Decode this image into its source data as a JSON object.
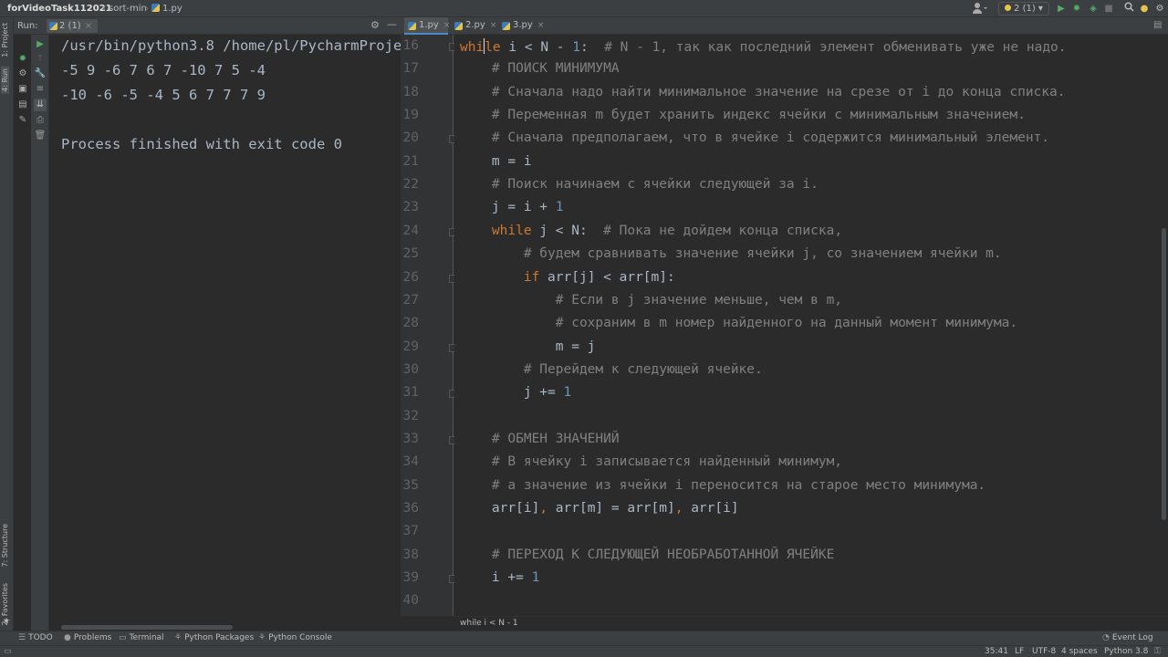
{
  "topbar": {
    "project": "forVideoTask112021",
    "sep": "›",
    "folder": "sort-min",
    "file": "1.py",
    "user_icon": "user-icon",
    "run_config": "2 (1)"
  },
  "sidebar": {
    "project": "1: Project",
    "run": "4: Run",
    "structure": "7: Structure",
    "favorites": "2: Favorites"
  },
  "run_panel": {
    "label": "Run:",
    "tab": "2 (1)",
    "tab_close": "×",
    "console_lines": [
      "/usr/bin/python3.8 /home/pl/PycharmProje",
      "-5 9 -6 7 6 7 -10 7 5 -4",
      "-10 -6 -5 -4 5 6 7 7 7 9",
      "",
      "Process finished with exit code 0"
    ]
  },
  "editor": {
    "tabs": [
      {
        "label": "1.py",
        "active": true
      },
      {
        "label": "2.py",
        "active": false
      },
      {
        "label": "3.py",
        "active": false
      }
    ],
    "tab_close": "×",
    "breadcrumb": "while i < N - 1",
    "lines": [
      {
        "n": "16",
        "tokens": [
          [
            "kw",
            "whi"
          ],
          [
            "caret",
            ""
          ],
          [
            "kw",
            "le"
          ],
          [
            "t",
            " i < N - "
          ],
          [
            "num",
            "1"
          ],
          [
            "t",
            ":  "
          ],
          [
            "cm",
            "# N - 1, так как последний элемент обменивать уже не надо."
          ]
        ]
      },
      {
        "n": "17",
        "tokens": [
          [
            "t",
            "    "
          ],
          [
            "cm",
            "# ПОИСК МИНИМУМА"
          ]
        ]
      },
      {
        "n": "18",
        "tokens": [
          [
            "t",
            "    "
          ],
          [
            "cm",
            "# Сначала надо найти минимальное значение на срезе от i до конца списка."
          ]
        ]
      },
      {
        "n": "19",
        "tokens": [
          [
            "t",
            "    "
          ],
          [
            "cm",
            "# Переменная m будет хранить индекс ячейки с минимальным значением."
          ]
        ]
      },
      {
        "n": "20",
        "tokens": [
          [
            "t",
            "    "
          ],
          [
            "cm",
            "# Сначала предполагаем, что в ячейке i содержится минимальный элемент."
          ]
        ]
      },
      {
        "n": "21",
        "tokens": [
          [
            "t",
            "    m = i"
          ]
        ]
      },
      {
        "n": "22",
        "tokens": [
          [
            "t",
            "    "
          ],
          [
            "cm",
            "# Поиск начинаем с ячейки следующей за i."
          ]
        ]
      },
      {
        "n": "23",
        "tokens": [
          [
            "t",
            "    j = i + "
          ],
          [
            "num",
            "1"
          ]
        ]
      },
      {
        "n": "24",
        "tokens": [
          [
            "t",
            "    "
          ],
          [
            "kw",
            "while"
          ],
          [
            "t",
            " j < N:  "
          ],
          [
            "cm",
            "# Пока не дойдем конца списка,"
          ]
        ]
      },
      {
        "n": "25",
        "tokens": [
          [
            "t",
            "        "
          ],
          [
            "cm",
            "# будем сравнивать значение ячейки j, со значением ячейки m."
          ]
        ]
      },
      {
        "n": "26",
        "tokens": [
          [
            "t",
            "        "
          ],
          [
            "kw",
            "if"
          ],
          [
            "t",
            " arr[j] < arr[m]:"
          ]
        ]
      },
      {
        "n": "27",
        "tokens": [
          [
            "t",
            "            "
          ],
          [
            "cm",
            "# Если в j значение меньше, чем в m,"
          ]
        ]
      },
      {
        "n": "28",
        "tokens": [
          [
            "t",
            "            "
          ],
          [
            "cm",
            "# сохраним в m номер найденного на данный момент минимума."
          ]
        ]
      },
      {
        "n": "29",
        "tokens": [
          [
            "t",
            "            m = j"
          ]
        ]
      },
      {
        "n": "30",
        "tokens": [
          [
            "t",
            "        "
          ],
          [
            "cm",
            "# Перейдем к следующей ячейке."
          ]
        ]
      },
      {
        "n": "31",
        "tokens": [
          [
            "t",
            "        j += "
          ],
          [
            "num",
            "1"
          ]
        ]
      },
      {
        "n": "32",
        "tokens": []
      },
      {
        "n": "33",
        "tokens": [
          [
            "t",
            "    "
          ],
          [
            "cm",
            "# ОБМЕН ЗНАЧЕНИЙ"
          ]
        ]
      },
      {
        "n": "34",
        "tokens": [
          [
            "t",
            "    "
          ],
          [
            "cm",
            "# В ячейку i записывается найденный минимум,"
          ]
        ]
      },
      {
        "n": "35",
        "tokens": [
          [
            "t",
            "    "
          ],
          [
            "cm",
            "# а значение из ячейки i переносится на старое место минимума."
          ]
        ]
      },
      {
        "n": "36",
        "tokens": [
          [
            "t",
            "    arr[i]"
          ],
          [
            "punc",
            ","
          ],
          [
            "t",
            " arr[m] = arr[m]"
          ],
          [
            "punc",
            ","
          ],
          [
            "t",
            " arr[i]"
          ]
        ]
      },
      {
        "n": "37",
        "tokens": []
      },
      {
        "n": "38",
        "tokens": [
          [
            "t",
            "    "
          ],
          [
            "cm",
            "# ПЕРЕХОД К СЛЕДУЮЩЕЙ НЕОБРАБОТАННОЙ ЯЧЕЙКЕ"
          ]
        ]
      },
      {
        "n": "39",
        "tokens": [
          [
            "t",
            "    i += "
          ],
          [
            "num",
            "1"
          ]
        ]
      },
      {
        "n": "40",
        "tokens": []
      }
    ]
  },
  "bottom_tools": {
    "todo": "TODO",
    "problems": "Problems",
    "terminal": "Terminal",
    "python_packages": "Python Packages",
    "python_console": "Python Console",
    "event_log": "Event Log"
  },
  "status": {
    "position": "35:41",
    "line_sep": "LF",
    "encoding": "UTF-8",
    "indent": "4 spaces",
    "interpreter": "Python 3.8"
  },
  "colors": {
    "keyword": "#cc7832",
    "number": "#6897bb",
    "comment": "#808080",
    "text": "#a9b7c6",
    "background": "#2b2b2b"
  }
}
